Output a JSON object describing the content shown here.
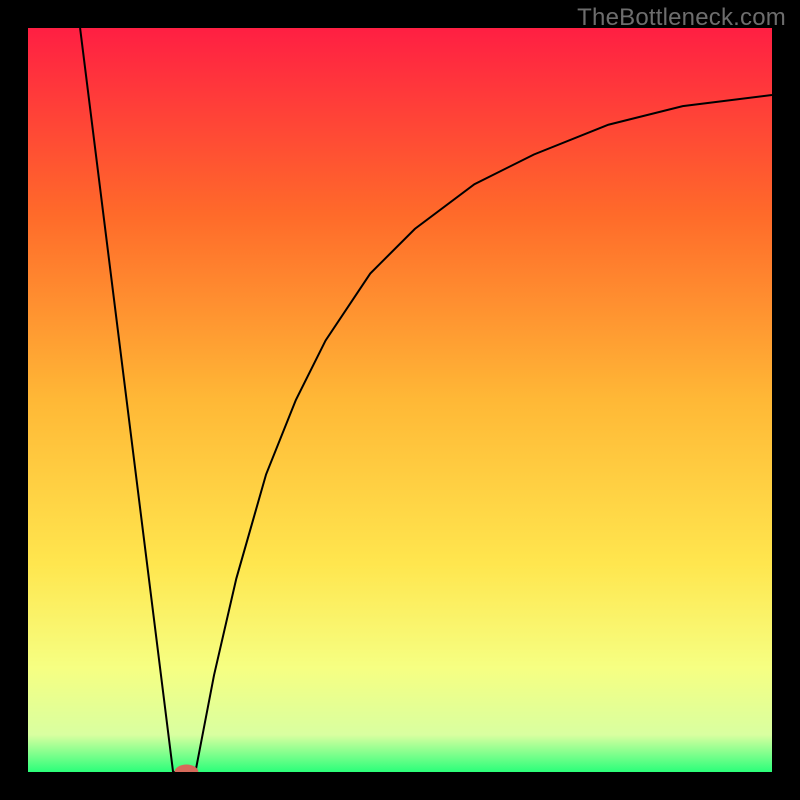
{
  "watermark": "TheBottleneck.com",
  "chart_data": {
    "type": "line",
    "title": "",
    "xlabel": "",
    "ylabel": "",
    "xlim": [
      0,
      100
    ],
    "ylim": [
      0,
      100
    ],
    "grid": false,
    "legend": false,
    "background_gradient_stops": [
      {
        "offset": 0,
        "color": "#ff1f43"
      },
      {
        "offset": 25,
        "color": "#ff6a2a"
      },
      {
        "offset": 50,
        "color": "#ffb836"
      },
      {
        "offset": 72,
        "color": "#ffe64e"
      },
      {
        "offset": 86,
        "color": "#f6ff82"
      },
      {
        "offset": 95,
        "color": "#d9ffa0"
      },
      {
        "offset": 100,
        "color": "#2bff7a"
      }
    ],
    "series": [
      {
        "name": "left-slope",
        "kind": "line",
        "color": "#000000",
        "x": [
          7,
          19.5
        ],
        "y": [
          100,
          0
        ]
      },
      {
        "name": "valley-flat",
        "kind": "line",
        "color": "#000000",
        "x": [
          19.5,
          22.5
        ],
        "y": [
          0,
          0
        ]
      },
      {
        "name": "right-curve",
        "kind": "line",
        "color": "#000000",
        "x": [
          22.5,
          25,
          28,
          32,
          36,
          40,
          46,
          52,
          60,
          68,
          78,
          88,
          100
        ],
        "y": [
          0,
          13,
          26,
          40,
          50,
          58,
          67,
          73,
          79,
          83,
          87,
          89.5,
          91
        ]
      }
    ],
    "marker": {
      "name": "bottleneck-min-marker",
      "shape": "ellipse",
      "color": "#d66a5a",
      "cx": 21.3,
      "cy": 0,
      "rx": 1.6,
      "ry": 1.0
    }
  }
}
